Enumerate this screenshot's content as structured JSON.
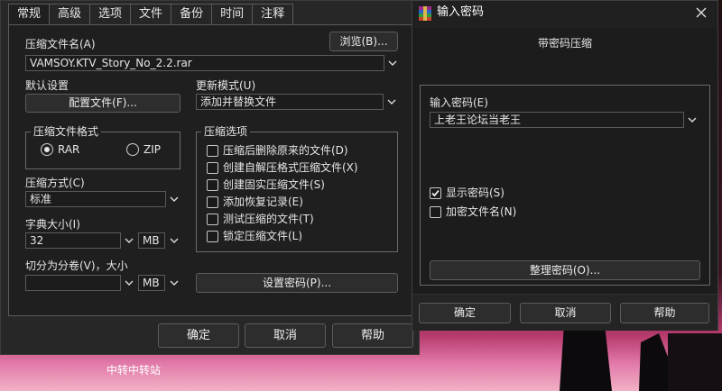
{
  "main_dialog": {
    "tabs": [
      "常规",
      "高级",
      "选项",
      "文件",
      "备份",
      "时间",
      "注释"
    ],
    "archive_name_label": "压缩文件名(A)",
    "browse_button": "浏览(B)...",
    "archive_name_value": "VAMSOY.KTV_Story_No_2.2.rar",
    "default_settings_label": "默认设置",
    "profile_button": "配置文件(F)...",
    "update_mode_label": "更新模式(U)",
    "update_mode_value": "添加并替换文件",
    "format_group_title": "压缩文件格式",
    "format_rar": "RAR",
    "format_zip": "ZIP",
    "options_group_title": "压缩选项",
    "options": [
      {
        "label": "压缩后删除原来的文件(D)",
        "checked": false
      },
      {
        "label": "创建自解压格式压缩文件(X)",
        "checked": false
      },
      {
        "label": "创建固实压缩文件(S)",
        "checked": false
      },
      {
        "label": "添加恢复记录(E)",
        "checked": false
      },
      {
        "label": "测试压缩的文件(T)",
        "checked": false
      },
      {
        "label": "锁定压缩文件(L)",
        "checked": false
      }
    ],
    "method_label": "压缩方式(C)",
    "method_value": "标准",
    "dict_label": "字典大小(I)",
    "dict_value": "32",
    "dict_unit": "MB",
    "split_label": "切分为分卷(V)，大小",
    "split_value": "",
    "split_unit": "MB",
    "set_password_button": "设置密码(P)...",
    "ok_button": "确定",
    "cancel_button": "取消",
    "help_button": "帮助"
  },
  "password_dialog": {
    "title": "输入密码",
    "subtitle": "带密码压缩",
    "password_label": "输入密码(E)",
    "password_value": "上老王论坛当老王",
    "show_password_label": "显示密码(S)",
    "show_password_checked": true,
    "encrypt_names_label": "加密文件名(N)",
    "encrypt_names_checked": false,
    "organize_button": "整理密码(O)...",
    "ok_button": "确定",
    "cancel_button": "取消",
    "help_button": "帮助"
  },
  "desktop": {
    "icon_label": "中转中转站"
  },
  "colors": {
    "dialog_bg": "#272727",
    "panel_bg": "#1f1f1f",
    "accent_pink": "#e27aa9"
  }
}
